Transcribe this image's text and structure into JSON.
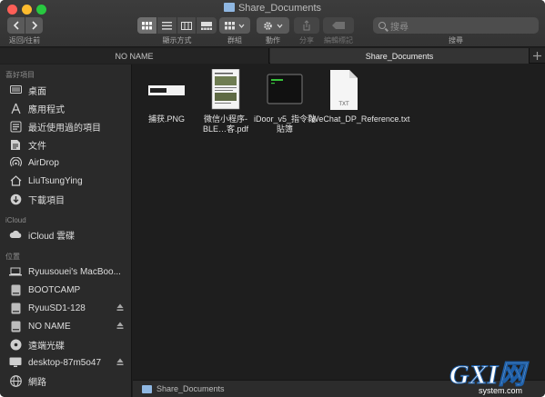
{
  "window": {
    "title": "Share_Documents"
  },
  "toolbar": {
    "nav_label": "返回/往前",
    "view_label": "顯示方式",
    "group_label": "群組",
    "action_label": "動作",
    "share_label": "分享",
    "tags_label": "編輯標記",
    "search_label": "搜尋",
    "search_placeholder": "搜尋"
  },
  "tabs": [
    "NO NAME",
    "Share_Documents"
  ],
  "sidebar": {
    "favorites_title": "喜好項目",
    "favorites": [
      {
        "label": "桌面",
        "icon": "desktop-icon"
      },
      {
        "label": "應用程式",
        "icon": "applications-icon"
      },
      {
        "label": "最近使用過的項目",
        "icon": "recents-icon"
      },
      {
        "label": "文件",
        "icon": "documents-icon"
      },
      {
        "label": "AirDrop",
        "icon": "airdrop-icon"
      },
      {
        "label": "LiuTsungYing",
        "icon": "home-icon"
      },
      {
        "label": "下載項目",
        "icon": "downloads-icon"
      }
    ],
    "icloud_title": "iCloud",
    "icloud": [
      {
        "label": "iCloud 雲碟",
        "icon": "cloud-icon"
      }
    ],
    "locations_title": "位置",
    "locations": [
      {
        "label": "Ryuusouei's MacBoo...",
        "icon": "laptop-icon"
      },
      {
        "label": "BOOTCAMP",
        "icon": "disk-icon"
      },
      {
        "label": "RyuuSD1-128",
        "icon": "disk-icon",
        "eject": true
      },
      {
        "label": "NO NAME",
        "icon": "disk-icon",
        "eject": true
      },
      {
        "label": "遠端光碟",
        "icon": "optical-disc-icon"
      },
      {
        "label": "desktop-87m5o47",
        "icon": "monitor-icon",
        "eject": true
      },
      {
        "label": "網路",
        "icon": "network-icon"
      }
    ]
  },
  "files": [
    {
      "name": "捕获.PNG",
      "icon": "png-file-icon"
    },
    {
      "name": "微信小程序-BLE…客.pdf",
      "icon": "pdf-file-icon"
    },
    {
      "name": "iDoor_v5_指令黏貼簿",
      "icon": "terminal-file-icon"
    },
    {
      "name": "WeChat_DP_Reference.txt",
      "icon": "txt-file-icon",
      "badge": "TXT"
    }
  ],
  "pathbar": {
    "item": "Share_Documents"
  },
  "watermark": {
    "text": "GXI网",
    "subtext": "system.com"
  },
  "colors": {
    "accent": "#8fb7e2",
    "close": "#fe5f57",
    "minimize": "#febc2e",
    "maximize": "#28c840"
  }
}
